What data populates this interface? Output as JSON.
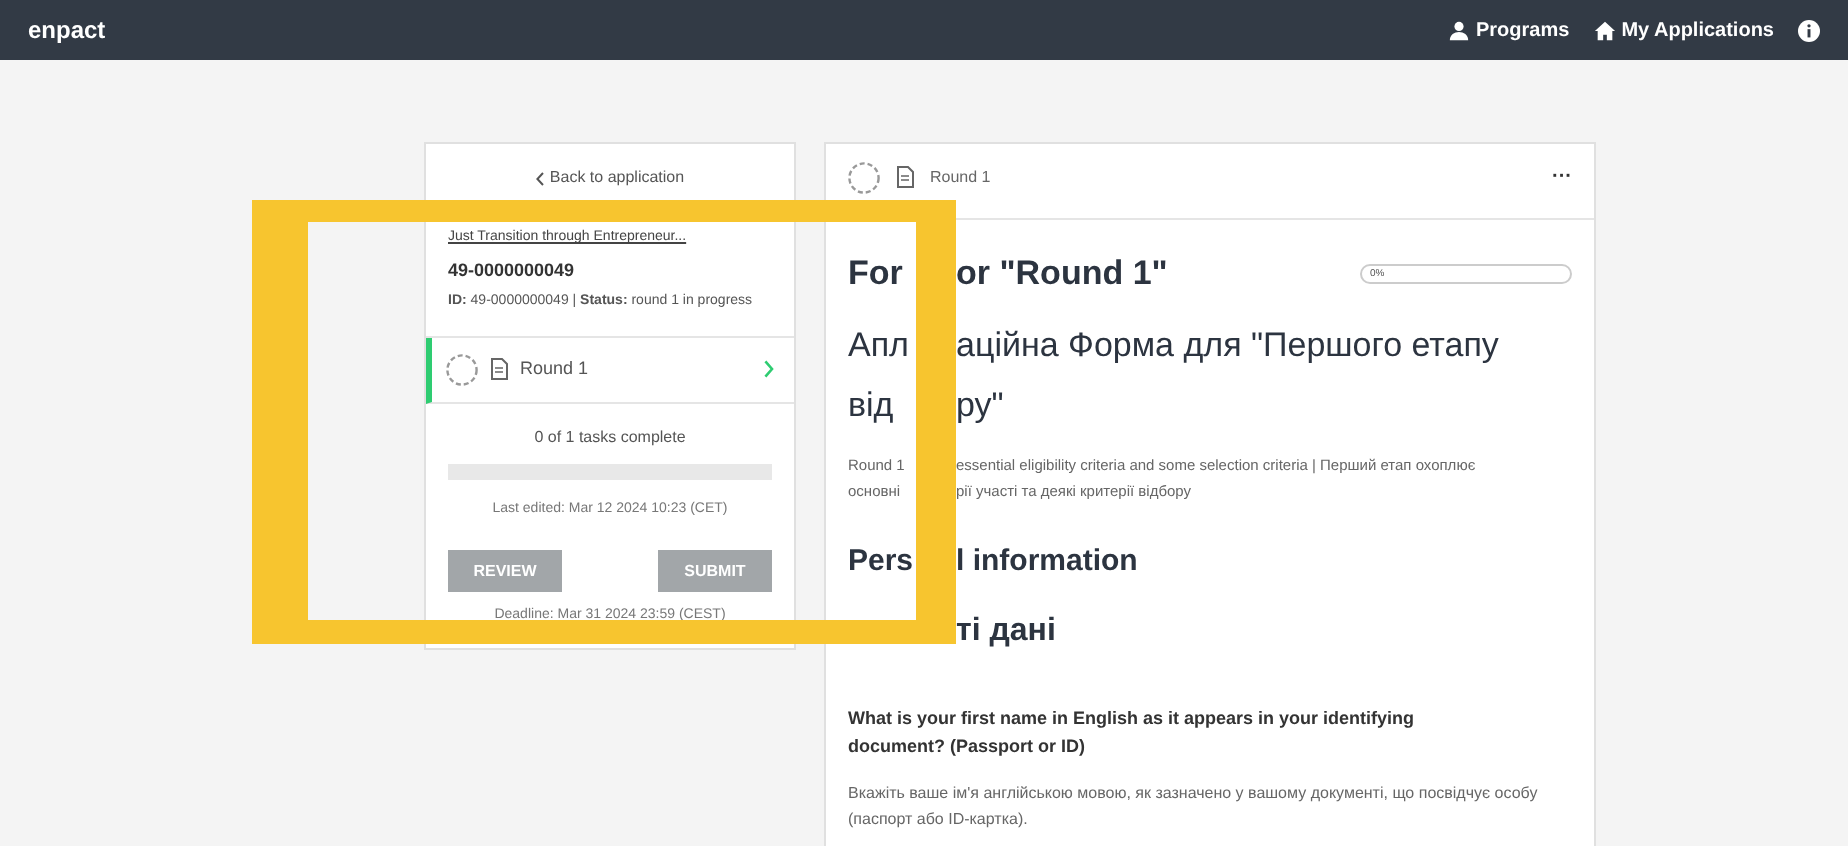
{
  "topbar": {
    "brand": "enpact",
    "nav": [
      {
        "label": "Programs",
        "kind": "programs"
      },
      {
        "label": "My Applications",
        "kind": "home"
      },
      {
        "kind": "info"
      }
    ]
  },
  "sidebar": {
    "back": "Back to application",
    "program": "Just Transition through Entrepreneur...",
    "app_number": "49-0000000049",
    "status_line": "**ID:** 49-0000000049 | **Status:** round 1 in progress",
    "tasks": [
      {
        "label": "Round 1",
        "selected": true
      }
    ],
    "progress_text": "0 of 1 tasks complete",
    "level": 0,
    "last_edited": "Last edited: Mar 12 2024 10:23 (CET)",
    "buttons": [
      {
        "label": "REVIEW",
        "disabled": true
      },
      {
        "label": "SUBMIT",
        "disabled": true
      }
    ],
    "deadline": "Deadline: Mar 31 2024 23:59 (CEST)"
  },
  "form": {
    "header_title": "Round 1",
    "menu": "···",
    "title": {
      "left": "For",
      "right": "or \"Round 1\""
    },
    "progress_label": "0%",
    "level": 0,
    "title_uk_lines": [
      {
        "left": "Апл",
        "right": "аційна Форма для \"Першого етапу"
      },
      {
        "left": "від",
        "right": "ру\""
      }
    ],
    "description_lines": [
      {
        "left": "Round 1",
        "right": "essential eligibility criteria and some selection criteria | Перший етап охоплює"
      },
      {
        "left": "основні",
        "right": "рії участі та деякі критерії відбору"
      }
    ],
    "section": {
      "left": "Pers",
      "right": "l information"
    },
    "section_uk": {
      "right": "ті дані"
    },
    "question": "What is your first name in English as it appears in your identifying document? (Passport or ID)",
    "hint": "Вкажіть ваше ім'я англійською мовою, як зазначено у вашому документі, що посвідчує особу (паспорт або ID-картка)."
  },
  "highlight": {
    "color": "#f7c52f"
  }
}
